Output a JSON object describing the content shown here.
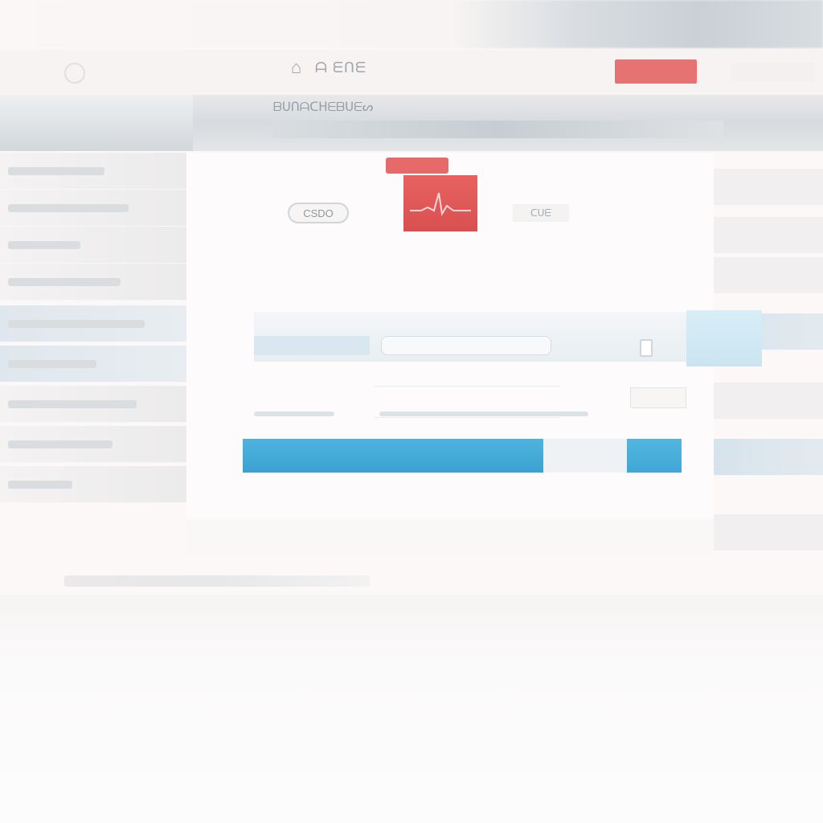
{
  "header": {
    "brand": "ᗩ ᗴᑎᗴ",
    "alert_label": "",
    "home_icon": "home-icon",
    "logo_icon": "bell-icon"
  },
  "band": {
    "title": "ᗷᑌᑎᗩᑕᕼᗴᗷᑌᗴᔕ"
  },
  "panel": {
    "title": "",
    "back_label": "CSDO",
    "next_label": "ᑕᑌᗴ",
    "info": {
      "head": "",
      "row": [
        "",
        "",
        "",
        ""
      ],
      "sub": ""
    },
    "row1": {
      "cell_a": "",
      "side_thumb": ""
    },
    "row2": {
      "label_a": "",
      "label_b": ""
    },
    "progress": {
      "label": "",
      "value": 0.8
    }
  },
  "footer": {
    "text": "",
    "link": "",
    "sub": ""
  },
  "colors": {
    "accent_red": "#e35a5a",
    "accent_blue": "#3aa2d2",
    "text_dark": "#4e5d69"
  }
}
